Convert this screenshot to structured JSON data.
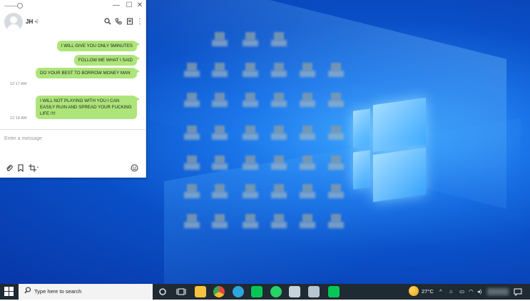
{
  "chat": {
    "contact_name": "JH",
    "header_icons": [
      "search-icon",
      "phone-icon",
      "notes-icon",
      "more-vertical-icon"
    ],
    "window_controls": {
      "minimize": "—",
      "maximize": "☐",
      "close": "✕"
    },
    "messages": [
      {
        "text": "I WILL GIVE YOU ONLY 5MINUTES",
        "time": ""
      },
      {
        "text": "FOLLOW ME WHAT I SAID",
        "time": ""
      },
      {
        "text": "DO YOUR BEST TO BORROW MONEY MAN",
        "time": "12:17 AM"
      },
      {
        "text": "I WILL NOT PLAYING WITH YOU I CAN EASILY RUIN AND SPREAD YOUR FUCKING LIFE !!!!",
        "time": "12:18 AM"
      }
    ],
    "input_placeholder": "Enter a message",
    "toolbar_icons": [
      "attach-icon",
      "bookmark-icon",
      "crop-icon",
      "emoji-icon"
    ]
  },
  "taskbar": {
    "search_placeholder": "Type here to search",
    "weather": "27°C",
    "pinned_icons": [
      "task-view-icon",
      "file-explorer-icon",
      "chrome-icon",
      "telegram-icon",
      "line-icon",
      "whatsapp-icon",
      "app-icon",
      "app-icon",
      "line-icon"
    ],
    "colors": {
      "taskbar": "#1f2a33",
      "bubble": "#aee57a",
      "desktop": "#0a4fc7"
    }
  }
}
